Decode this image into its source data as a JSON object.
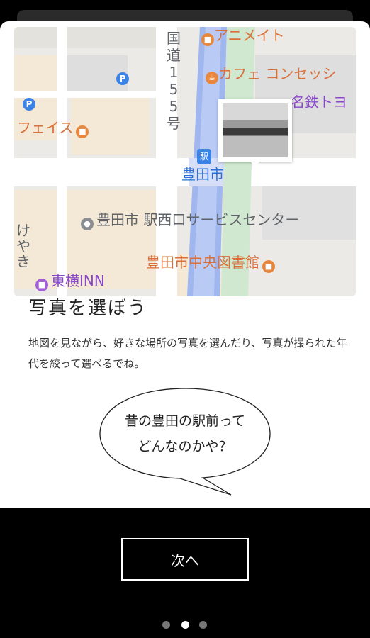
{
  "map": {
    "labels": {
      "animate": "アニメイト",
      "cafe": "カフェ コンセッシ",
      "meitetsu": "名鉄トヨ",
      "face": "フェイス",
      "station": "豊田市",
      "service_center": "豊田市 駅西口サービスセンター",
      "library": "豊田市中央図書館",
      "keyaki": "けやき",
      "inn": "東横INN",
      "route": "国道155号"
    },
    "icons": [
      "parking-icon",
      "station-icon",
      "shop-icon",
      "cafe-icon",
      "service-icon"
    ]
  },
  "card": {
    "title": "写真を選ぼう",
    "description": "地図を見ながら、好きな場所の写真を選んだり、写真が撮られた年代を絞って選べるでね。",
    "bubble": {
      "line1": "昔の豊田の駅前って",
      "line2": "どんなのかや？"
    }
  },
  "navigation": {
    "next_label": "次へ",
    "page_count": 3,
    "current_page": 2
  },
  "colors": {
    "background": "#000000",
    "card": "#ffffff",
    "map_orange": "#d9703a",
    "map_purple": "#8a48c9",
    "map_blue": "#2a6fd6",
    "dot_active": "#ffffff",
    "dot_inactive": "#777777"
  }
}
